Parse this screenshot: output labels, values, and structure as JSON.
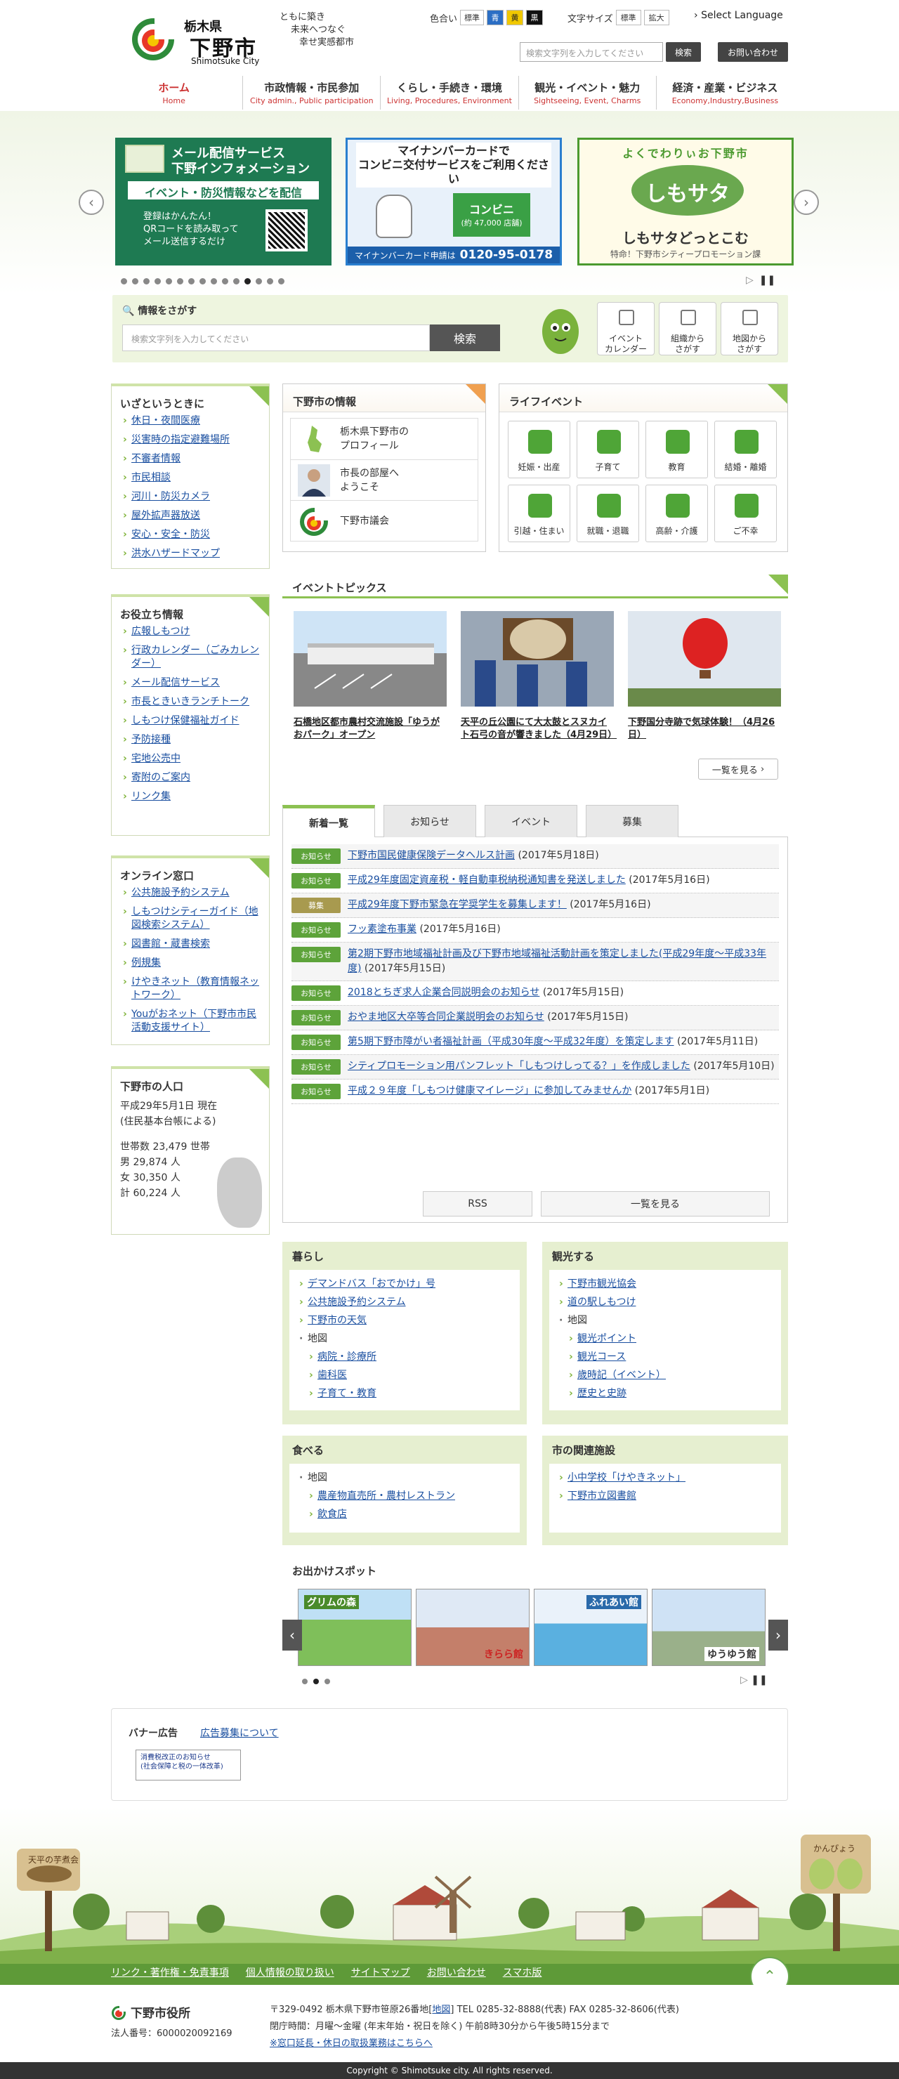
{
  "header": {
    "pref": "栃木県",
    "city": "下野市",
    "city_en": "Shimotsuke City",
    "slogan": [
      "ともに築き",
      "未来へつなぐ",
      "幸せ実感都市"
    ],
    "color_label": "色合い",
    "color_buttons": [
      "標準",
      "青",
      "黄",
      "黒"
    ],
    "font_label": "文字サイズ",
    "font_buttons": [
      "標準",
      "拡大"
    ],
    "language": "Select Language",
    "search_placeholder": "検索文字列を入力してください",
    "search_button": "検索",
    "contact": "お問い合わせ"
  },
  "gnav": [
    {
      "ja": "ホーム",
      "en": "Home"
    },
    {
      "ja": "市政情報・市民参加",
      "en": "City admin., Public participation"
    },
    {
      "ja": "くらし・手続き・環境",
      "en": "Living, Procedures, Environment"
    },
    {
      "ja": "観光・イベント・魅力",
      "en": "Sightseeing, Event, Charms"
    },
    {
      "ja": "経済・産業・ビジネス",
      "en": "Economy,Industry,Business"
    }
  ],
  "hero": {
    "b1_title": "メール配信サービス\n下野インフォメーション",
    "b1_band": "イベント・防災情報などを配信",
    "b1_text": "登録はかんたん！\nQRコードを読み取って\nメール送信するだけ",
    "b2_title": "マイナンバーカードで\nコンビニ交付サービスをご利用ください",
    "b2_conv": "コンビニ",
    "b2_conv_sub": "(約 47,000 店舗)",
    "b2_foot_label": "マイナンバーカード申請は",
    "b2_foot_tel": "0120-95-0178",
    "b3_top": "よくでわりぃお下野市",
    "b3_logo": "しもサタ",
    "b3_name": "しもサタどっとこむ",
    "b3_sub": "特命！下野市シティープロモーション課",
    "dots": 15,
    "active_dot": 12
  },
  "search_panel": {
    "title": "情報をさがす",
    "placeholder": "検索文字列を入力してください",
    "button": "検索",
    "links": [
      "イベント\nカレンダー",
      "組織から\nさがす",
      "地図から\nさがす"
    ]
  },
  "emergency": {
    "title": "いざというときに",
    "items": [
      "休日・夜間医療",
      "災害時の指定避難場所",
      "不審者情報",
      "市民相談",
      "河川・防災カメラ",
      "屋外拡声器放送",
      "安心・安全・防災",
      "洪水ハザードマップ"
    ]
  },
  "useful": {
    "title": "お役立ち情報",
    "items": [
      "広報しもつけ",
      "行政カレンダー（ごみカレンダー）",
      "メール配信サービス",
      "市長ときいきランチトーク",
      "しもつけ保健福祉ガイド",
      "予防接種",
      "宅地公売中",
      "寄附のご案内",
      "リンク集"
    ]
  },
  "online": {
    "title": "オンライン窓口",
    "items": [
      "公共施設予約システム",
      "しもつけシティーガイド（地図検索システム）",
      "図書館・蔵書検索",
      "例規集",
      "けやきネット（教育情報ネットワーク）",
      "Youがおネット（下野市市民活動支援サイト）"
    ]
  },
  "population": {
    "title": "下野市の人口",
    "date": "平成29年5月1日 現在",
    "note": "(住民基本台帳による)",
    "households": "世帯数 23,479 世帯",
    "male": "男 29,874 人",
    "female": "女 30,350 人",
    "total": "計 60,224 人"
  },
  "city_info": {
    "title": "下野市の情報",
    "items": [
      "栃木県下野市の\nプロフィール",
      "市長の部屋へ\nようこそ",
      "下野市議会"
    ]
  },
  "life_events": {
    "title": "ライフイベント",
    "items": [
      "妊娠・出産",
      "子育て",
      "教育",
      "結婚・離婚",
      "引越・住まい",
      "就職・退職",
      "高齢・介護",
      "ご不幸"
    ]
  },
  "topics": {
    "title": "イベントトピックス",
    "cards": [
      "石橋地区都市農村交流施設「ゆうがおパーク」オープン",
      "天平の丘公園にて大太鼓とスヌカイト石弓の音が響きました（4月29日）",
      "下野国分寺跡で気球体験！（4月26日）"
    ],
    "more": "一覧を見る"
  },
  "news": {
    "tabs": [
      "新着一覧",
      "お知らせ",
      "イベント",
      "募集"
    ],
    "items": [
      {
        "tag": "お知らせ",
        "title": "下野市国民健康保険データヘルス計画",
        "date": "(2017年5月18日)"
      },
      {
        "tag": "お知らせ",
        "title": "平成29年度固定資産税・軽自動車税納税通知書を発送しました",
        "date": "(2017年5月16日)"
      },
      {
        "tag": "募集",
        "title": "平成29年度下野市緊急在学奨学生を募集します！",
        "date": "(2017年5月16日)"
      },
      {
        "tag": "お知らせ",
        "title": "フッ素塗布事業",
        "date": "(2017年5月16日)"
      },
      {
        "tag": "お知らせ",
        "title": "第2期下野市地域福祉計画及び下野市地域福祉活動計画を策定しました(平成29年度～平成33年度)",
        "date": "(2017年5月15日)"
      },
      {
        "tag": "お知らせ",
        "title": "2018とちぎ求人企業合同説明会のお知らせ",
        "date": "(2017年5月15日)"
      },
      {
        "tag": "お知らせ",
        "title": "おやま地区大卒等合同企業説明会のお知らせ",
        "date": "(2017年5月15日)"
      },
      {
        "tag": "お知らせ",
        "title": "第5期下野市障がい者福祉計画（平成30年度～平成32年度）を策定します",
        "date": "(2017年5月11日)"
      },
      {
        "tag": "お知らせ",
        "title": "シティプロモーション用パンフレット「しもつけしってる？」を作成しました",
        "date": "(2017年5月10日)"
      },
      {
        "tag": "お知らせ",
        "title": "平成２９年度「しもつけ健康マイレージ」に参加してみませんか",
        "date": "(2017年5月1日)"
      }
    ],
    "rss": "RSS",
    "more": "一覧を見る"
  },
  "living": {
    "title": "暮らし",
    "links": [
      "デマンドバス「おでかけ」号",
      "公共施設予約システム",
      "下野市の天気"
    ],
    "map_label": "地図",
    "sub": [
      "病院・診療所",
      "歯科医",
      "子育て・教育"
    ]
  },
  "sightseeing": {
    "title": "観光する",
    "links": [
      "下野市観光協会",
      "道の駅しもつけ"
    ],
    "map_label": "地図",
    "sub": [
      "観光ポイント",
      "観光コース",
      "歳時記（イベント）",
      "歴史と史跡"
    ]
  },
  "food": {
    "title": "食べる",
    "map_label": "地図",
    "sub": [
      "農産物直売所・農村レストラン",
      "飲食店"
    ]
  },
  "related": {
    "title": "市の関連施設",
    "links": [
      "小中学校「けやきネット」",
      "下野市立図書館"
    ]
  },
  "spots": {
    "title": "お出かけスポット",
    "labels": [
      "グリムの森",
      "きらら館",
      "ふれあい館",
      "ゆうゆう館"
    ]
  },
  "ads": {
    "title": "バナー広告",
    "link": "広告募集について",
    "banner": "消費税改正のお知らせ\n(社会保障と税の一体改革)"
  },
  "scene": {
    "sign_left": "天平の芋煮会",
    "sign_right": "かんぴょう"
  },
  "footer": {
    "links": [
      "リンク・著作権・免責事項",
      "個人情報の取り扱い",
      "サイトマップ",
      "お問い合わせ",
      "スマホ版"
    ],
    "name": "下野市役所",
    "corp": "法人番号：6000020092169",
    "address_pre": "〒329-0492 栃木県下野市笹原26番地[",
    "address_map": "地図",
    "address_post": "]   TEL 0285-32-8888(代表)   FAX 0285-32-8606(代表)",
    "hours": "閉庁時間：月曜～金曜 (年末年始・祝日を除く) 午前8時30分から午後5時15分まで",
    "window": "※窓口延長・休日の取扱業務はこちらへ",
    "copyright": "Copyright © Shimotsuke city. All rights reserved."
  },
  "colors": {
    "accent_green": "#8cc152",
    "nav_red": "#cc3333",
    "tag_green": "#5da33a"
  }
}
